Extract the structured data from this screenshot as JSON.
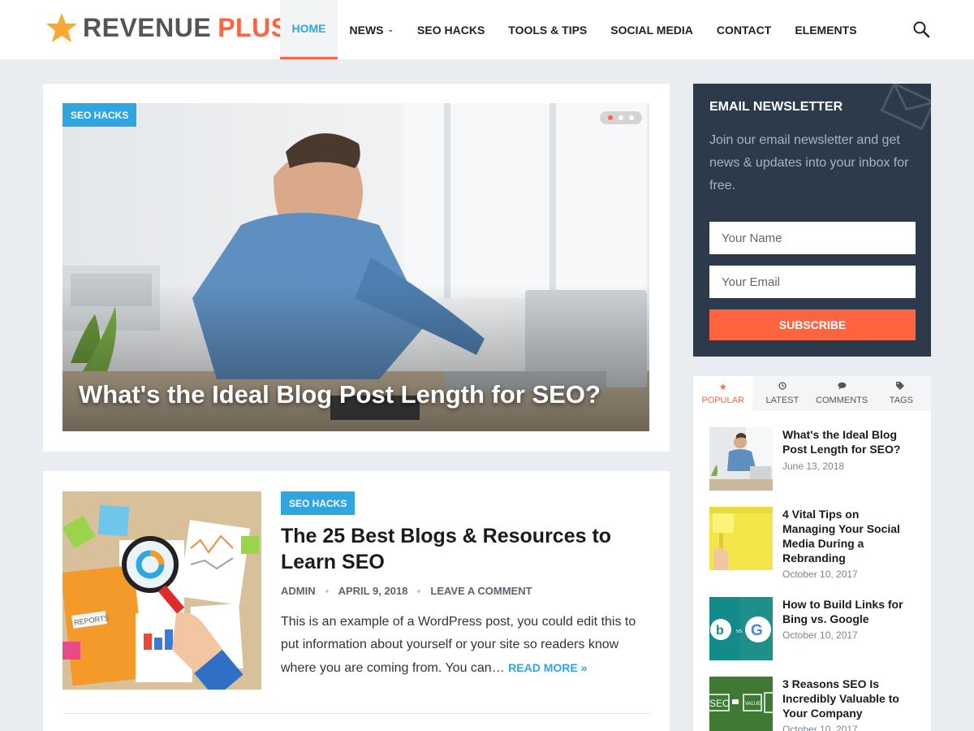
{
  "brand": {
    "name_part1": "REVENUE",
    "name_part2": "PLUS",
    "icon": "star-icon",
    "colors": {
      "accent": "#ff6440",
      "link": "#2fa6e0",
      "dark": "#2c3a4b",
      "star": "#f7a934"
    }
  },
  "nav": {
    "items": [
      {
        "label": "HOME",
        "active": true
      },
      {
        "label": "NEWS",
        "has_dropdown": true
      },
      {
        "label": "SEO HACKS"
      },
      {
        "label": "TOOLS & TIPS"
      },
      {
        "label": "SOCIAL MEDIA"
      },
      {
        "label": "CONTACT"
      },
      {
        "label": "ELEMENTS"
      }
    ],
    "search_icon": "search-icon"
  },
  "hero": {
    "category": "SEO HACKS",
    "title": "What's the Ideal Blog Post Length for SEO?",
    "slides": 3,
    "active_slide": 1
  },
  "post": {
    "category": "SEO HACKS",
    "title": "The 25 Best Blogs & Resources to Learn SEO",
    "author": "ADMIN",
    "date": "APRIL 9, 2018",
    "comments": "LEAVE A COMMENT",
    "excerpt": "This is an example of a WordPress post, you could edit this to put information about yourself or your site so readers know where you are coming from. You can…",
    "read_more": "READ MORE »"
  },
  "newsletter": {
    "title": "EMAIL NEWSLETTER",
    "text": "Join our email newsletter and get news & updates into your inbox for free.",
    "name_placeholder": "Your Name",
    "email_placeholder": "Your Email",
    "button": "SUBSCRIBE"
  },
  "tabs": {
    "items": [
      {
        "label": "POPULAR",
        "icon": "star-icon",
        "active": true
      },
      {
        "label": "LATEST",
        "icon": "clock-icon"
      },
      {
        "label": "COMMENTS",
        "icon": "comment-icon"
      },
      {
        "label": "TAGS",
        "icon": "tag-icon"
      }
    ],
    "popular": [
      {
        "title": "What's the Ideal Blog Post Length for SEO?",
        "date": "June 13, 2018"
      },
      {
        "title": "4 Vital Tips on Managing Your Social Media During a Rebranding",
        "date": "October 10, 2017"
      },
      {
        "title": "How to Build Links for Bing vs. Google",
        "date": "October 10, 2017"
      },
      {
        "title": "3 Reasons SEO Is Incredibly Valuable to Your Company",
        "date": "October 10, 2017"
      }
    ],
    "thumb_labels": {
      "vs": "vs",
      "seo": "SEO",
      "value": "VALUE"
    }
  }
}
